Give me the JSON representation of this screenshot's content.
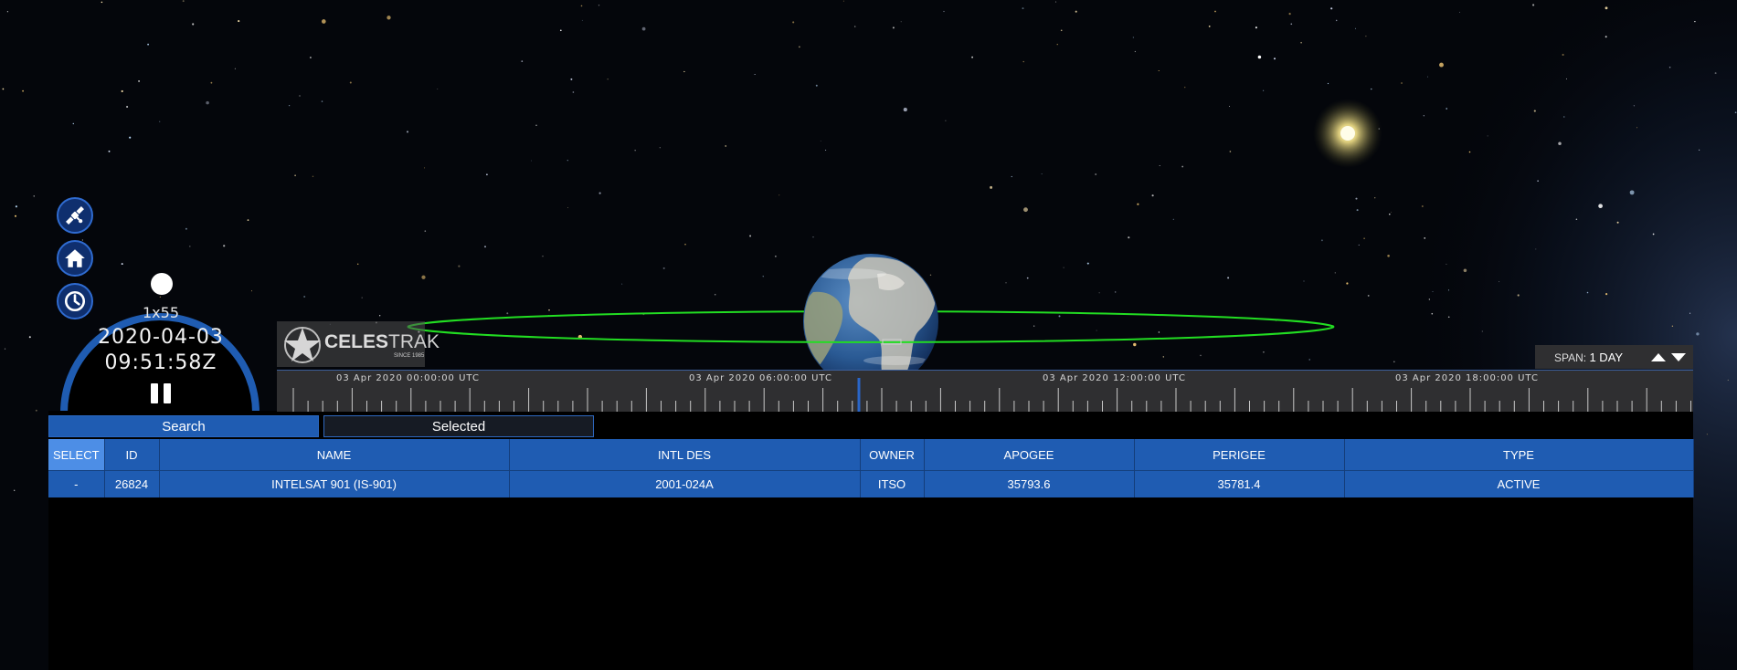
{
  "nav_buttons": [
    {
      "name": "satellite-icon"
    },
    {
      "name": "home-icon"
    },
    {
      "name": "clock-icon"
    }
  ],
  "clock": {
    "speed": "1x55",
    "date": "2020-04-03",
    "time": "09:51:58Z",
    "control_icon": "pause-icon"
  },
  "logo": {
    "text_bold": "CELES",
    "text_thin": "TRAK",
    "since": "SINCE 1985"
  },
  "timeline": {
    "labels": [
      "03 Apr 2020 00:00:00 UTC",
      "03 Apr 2020 06:00:00 UTC",
      "03 Apr 2020 12:00:00 UTC",
      "03 Apr 2020 18:00:00 UTC"
    ],
    "current_fraction": 0.41
  },
  "span": {
    "label": "SPAN:",
    "value": "1 DAY"
  },
  "tabs": [
    "Search",
    "Selected"
  ],
  "table": {
    "columns": [
      "SELECT",
      "ID",
      "NAME",
      "INTL DES",
      "OWNER",
      "APOGEE",
      "PERIGEE",
      "TYPE"
    ],
    "rows": [
      [
        "-",
        "26824",
        "INTELSAT 901 (IS-901)",
        "2001-024A",
        "ITSO",
        "35793.6",
        "35781.4",
        "ACTIVE"
      ]
    ]
  },
  "colors": {
    "accent": "#1f5cb2",
    "orbit": "#22dd22",
    "timeline_bg": "#2f2f31"
  }
}
